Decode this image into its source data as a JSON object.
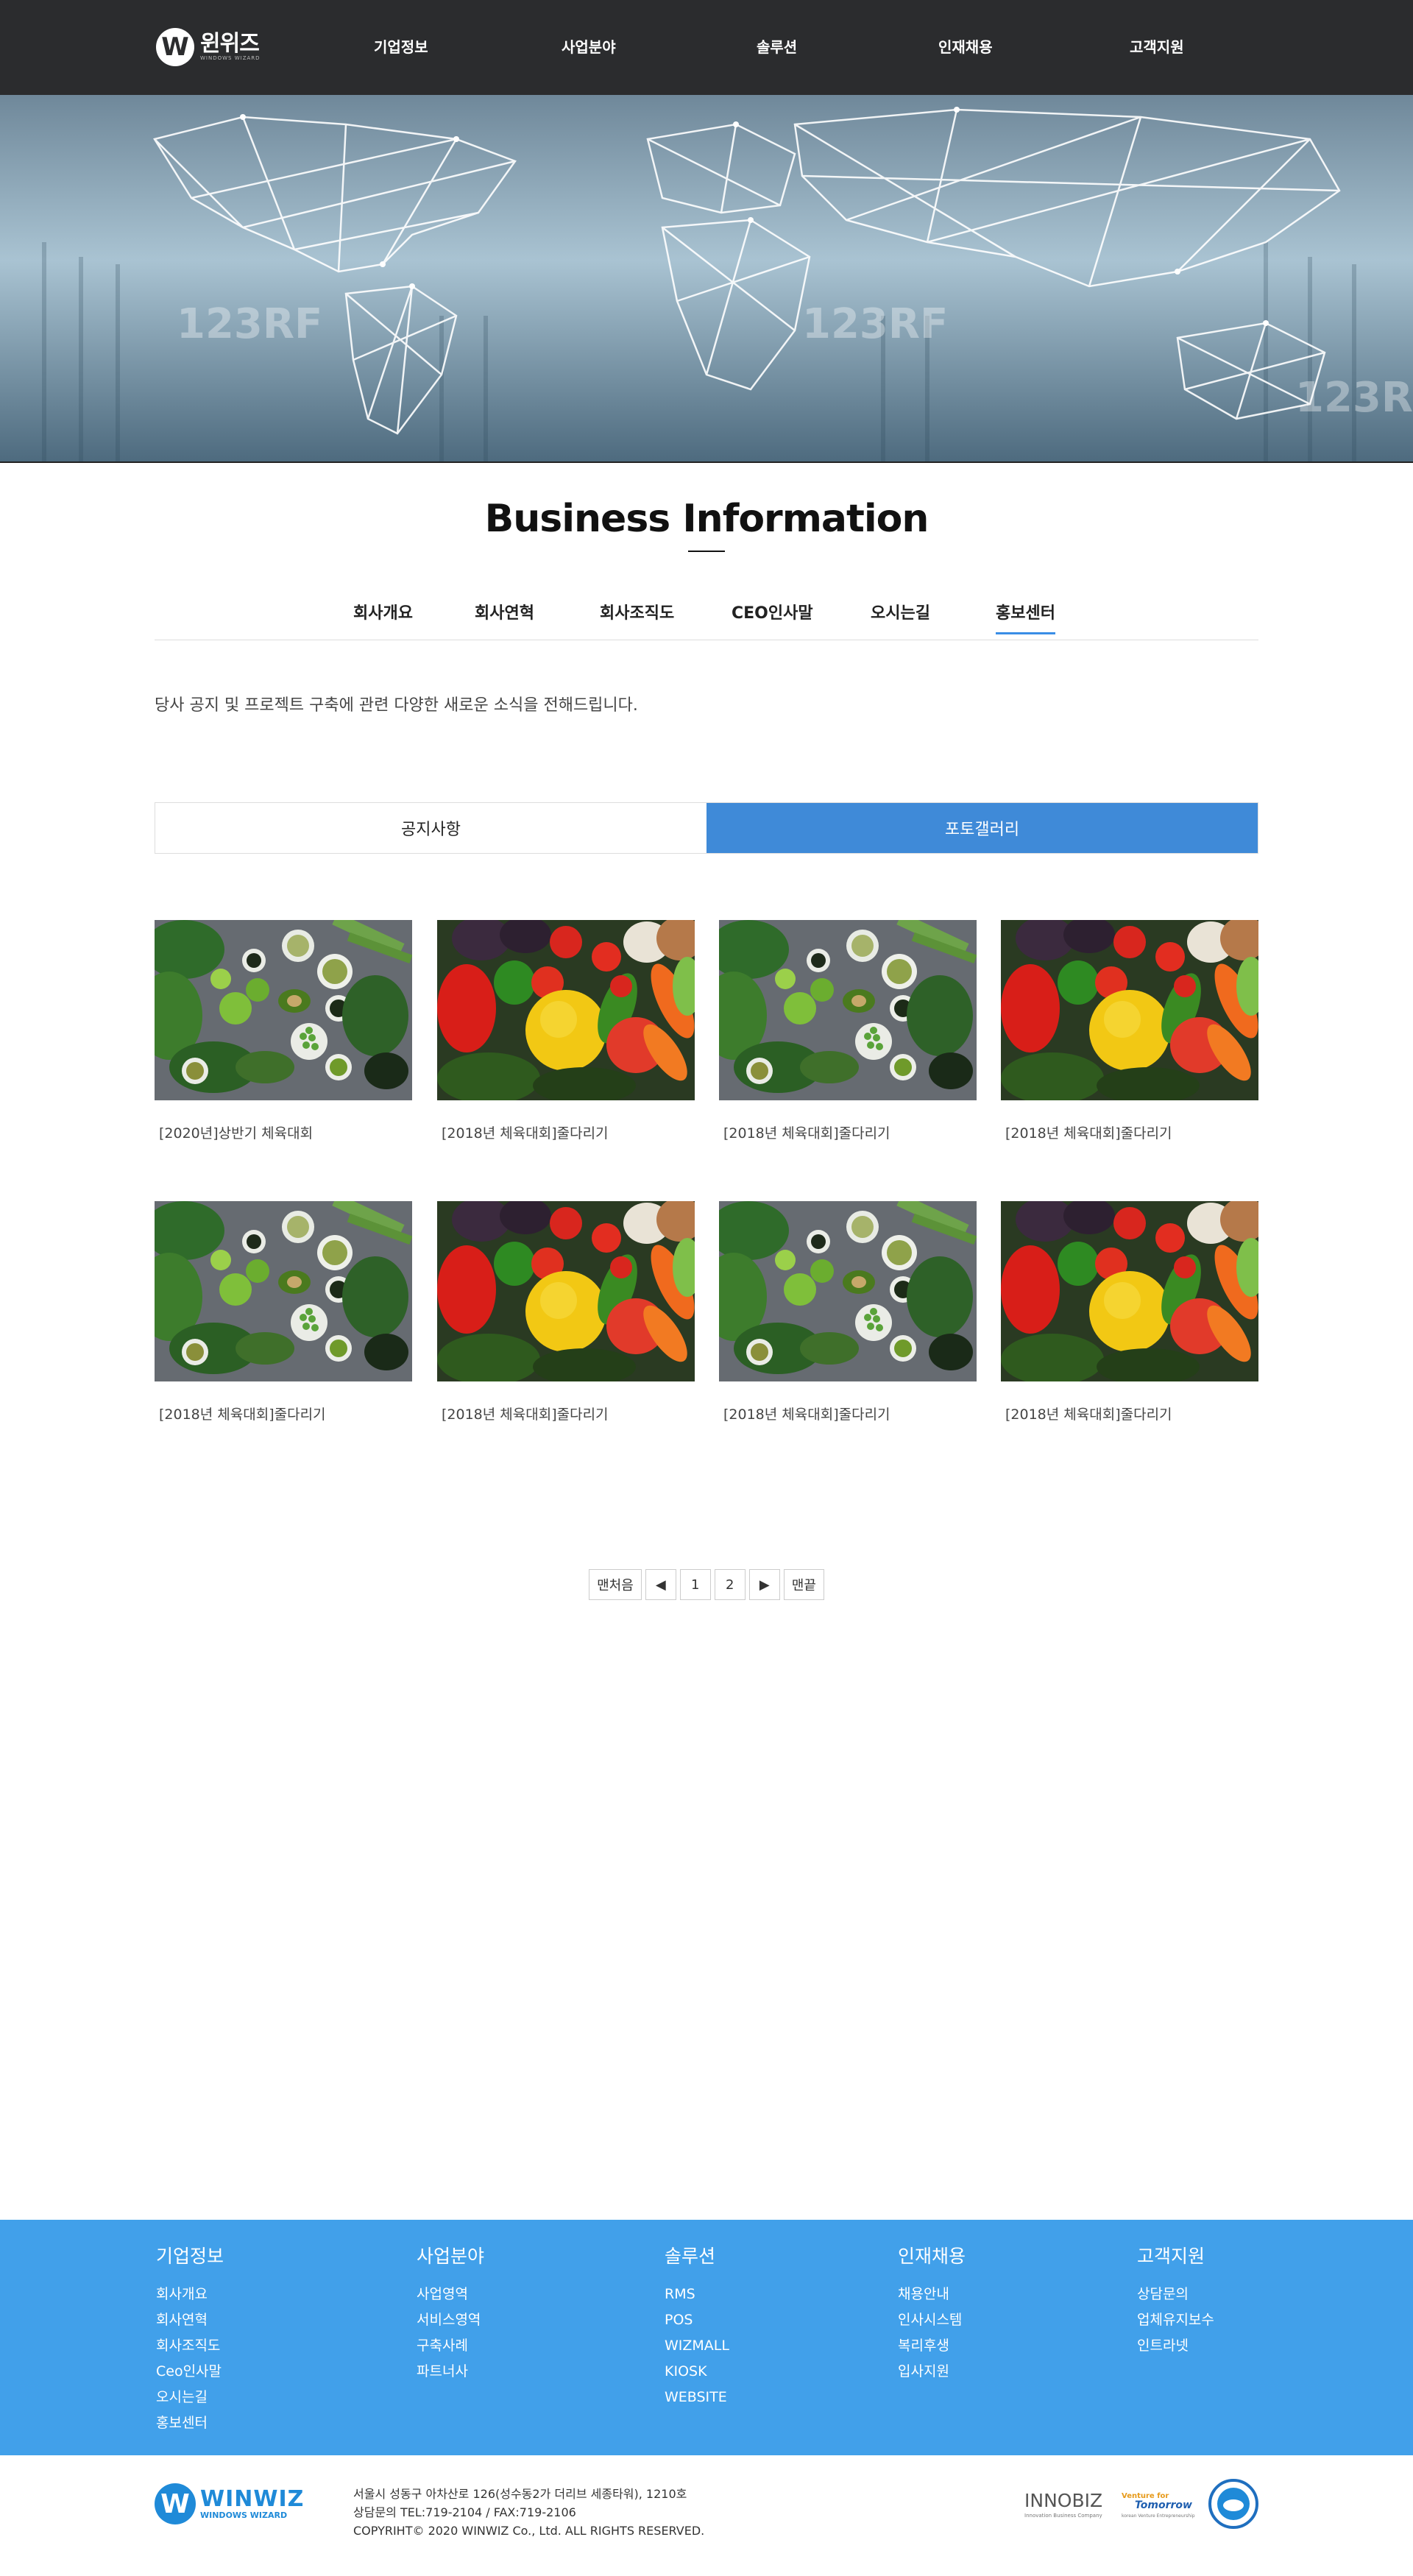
{
  "header": {
    "logo_korean": "윈위즈",
    "logo_english": "WINDOWS WIZARD",
    "nav": [
      "기업정보",
      "사업분야",
      "솔루션",
      "인재채용",
      "고객지원"
    ]
  },
  "hero": {
    "watermarks": [
      "123RF",
      "123RF",
      "123RF"
    ]
  },
  "page": {
    "title": "Business Information",
    "subnav": [
      "회사개요",
      "회사연혁",
      "회사조직도",
      "CEO인사말",
      "오시는길",
      "홍보센터"
    ],
    "active_subnav": "홍보센터",
    "intro": "당사 공지 및 프로젝트 구축에 관련 다양한 새로운 소식을 전해드립니다."
  },
  "board": {
    "tabs": [
      "공지사항",
      "포토갤러리"
    ],
    "active_tab": "포토갤러리"
  },
  "gallery": {
    "items": [
      {
        "caption": "[2020년]상반기 체육대회",
        "image": "greens"
      },
      {
        "caption": "[2018년 체육대회]줄다리기",
        "image": "peppers"
      },
      {
        "caption": "[2018년 체육대회]줄다리기",
        "image": "greens"
      },
      {
        "caption": "[2018년 체육대회]줄다리기",
        "image": "peppers"
      },
      {
        "caption": "[2018년 체육대회]줄다리기",
        "image": "greens"
      },
      {
        "caption": "[2018년 체육대회]줄다리기",
        "image": "peppers"
      },
      {
        "caption": "[2018년 체육대회]줄다리기",
        "image": "greens"
      },
      {
        "caption": "[2018년 체육대회]줄다리기",
        "image": "peppers"
      }
    ]
  },
  "pagination": {
    "first": "맨처음",
    "prev": "◀",
    "pages": [
      "1",
      "2"
    ],
    "next": "▶",
    "last": "맨끝"
  },
  "footer": {
    "columns": [
      {
        "title": "기업정보",
        "links": [
          "회사개요",
          "회사연혁",
          "회사조직도",
          "Ceo인사말",
          "오시는길",
          "홍보센터"
        ]
      },
      {
        "title": "사업분야",
        "links": [
          "사업영역",
          "서비스영역",
          "구축사례",
          "파트너사"
        ]
      },
      {
        "title": "솔루션",
        "links": [
          "RMS",
          "POS",
          "WIZMALL",
          "KIOSK",
          "WEBSITE"
        ]
      },
      {
        "title": "인재채용",
        "links": [
          "채용안내",
          "인사시스템",
          "복리후생",
          "입사지원"
        ]
      },
      {
        "title": "고객지원",
        "links": [
          "상담문의",
          "업체유지보수",
          "인트라넷"
        ]
      }
    ],
    "logo_text": "WINWIZ",
    "logo_sub": "WINDOWS WIZARD",
    "address": "서울시 성동구 아차산로 126(성수동2가 더리브 세종타워), 1210호",
    "contact": "상담문의 TEL:719-2104 / FAX:719-2106",
    "copyright": "COPYRIHT© 2020 WINWIZ Co., Ltd. ALL RIGHTS RESERVED.",
    "cert_innobiz": "INNOBIZ",
    "cert_innobiz_sub": "Innovation Business Company",
    "cert_venture": "Venture for",
    "cert_venture_big": "Tomorrow",
    "cert_venture_sub": "korean Venture Entrepreneurship"
  },
  "colors": {
    "header_bg": "#2b2c2e",
    "accent": "#3f8ad8",
    "footer_bg": "#41a0ea"
  }
}
